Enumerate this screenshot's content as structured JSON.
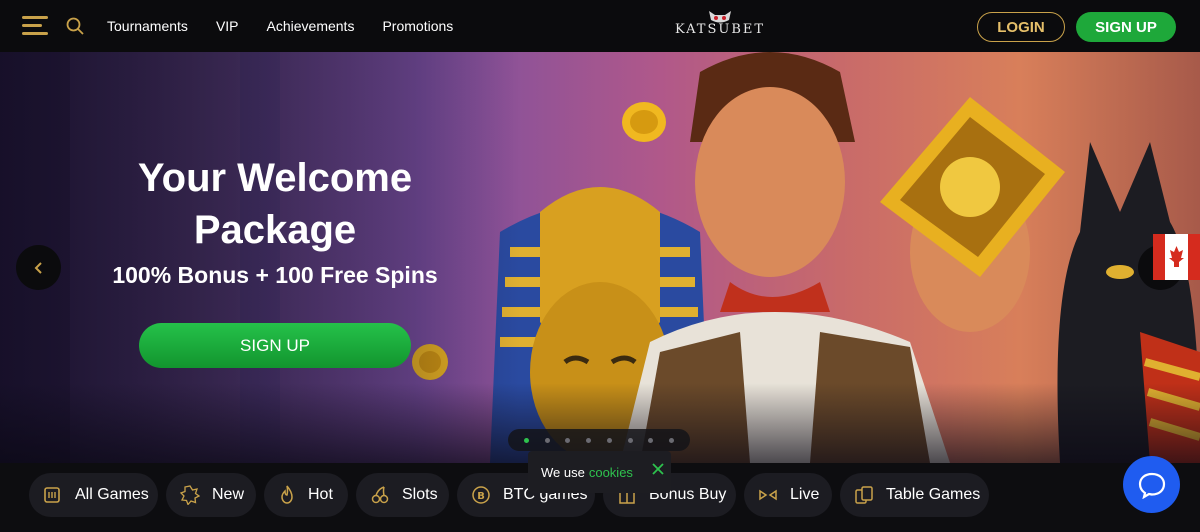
{
  "header": {
    "menu_icon": "hamburger-icon",
    "search_icon": "search-icon",
    "nav": [
      "Tournaments",
      "VIP",
      "Achievements",
      "Promotions"
    ],
    "logo_text": "KATSUBET",
    "login_label": "LOGIN",
    "signup_label": "SIGN UP"
  },
  "hero": {
    "title_line1": "Your Welcome",
    "title_line2": "Package",
    "subtitle": "100% Bonus + 100 Free Spins",
    "cta_label": "SIGN UP",
    "slide_count": 8,
    "active_slide": 1,
    "flag_icon": "canada-flag-icon"
  },
  "categories": [
    {
      "label": "All Games",
      "icon": "all-games-icon"
    },
    {
      "label": "New",
      "icon": "new-icon"
    },
    {
      "label": "Hot",
      "icon": "flame-icon"
    },
    {
      "label": "Slots",
      "icon": "cherries-icon"
    },
    {
      "label": "BTC games",
      "icon": "bitcoin-icon"
    },
    {
      "label": "Bonus Buy",
      "icon": "bonus-buy-icon"
    },
    {
      "label": "Live",
      "icon": "live-icon"
    },
    {
      "label": "Table Games",
      "icon": "table-games-icon"
    }
  ],
  "cookie": {
    "text": "We use",
    "link": "cookies"
  },
  "colors": {
    "accent_gold": "#c9a24a",
    "green": "#1ea83a",
    "chat_blue": "#1f5cf0"
  }
}
